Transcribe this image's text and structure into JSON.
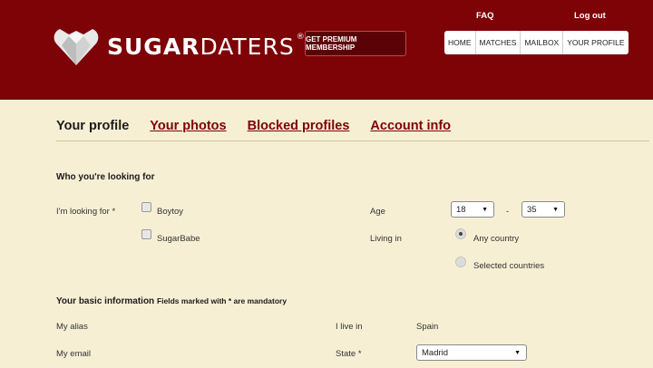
{
  "header": {
    "logo": {
      "sugar": "SUGAR",
      "daters": "DATERS",
      "reg": "®"
    },
    "premium_label": "GET PREMIUM MEMBERSHIP",
    "faq": "FAQ",
    "logout": "Log out",
    "nav": [
      "HOME",
      "MATCHES",
      "MAILBOX",
      "YOUR PROFILE"
    ],
    "colors": {
      "brand": "#7d0307",
      "background": "#f6efd3"
    }
  },
  "tabs": [
    {
      "label": "Your profile",
      "active": true
    },
    {
      "label": "Your photos",
      "active": false
    },
    {
      "label": "Blocked profiles",
      "active": false
    },
    {
      "label": "Account info",
      "active": false
    }
  ],
  "looking": {
    "title": "Who you're looking for",
    "looking_for_label": "I'm looking for *",
    "options": [
      "Boytoy",
      "SugarBabe"
    ],
    "age_label": "Age",
    "age_min": "18",
    "age_sep": "-",
    "age_max": "35",
    "living_label": "Living in",
    "living_options": [
      "Any country",
      "Selected countries"
    ]
  },
  "basic": {
    "title": "Your basic information",
    "note": "Fields marked with * are mandatory",
    "alias_label": "My alias",
    "email_label": "My email",
    "live_label": "I live in",
    "live_value": "Spain",
    "state_label": "State *",
    "state_value": "Madrid"
  }
}
